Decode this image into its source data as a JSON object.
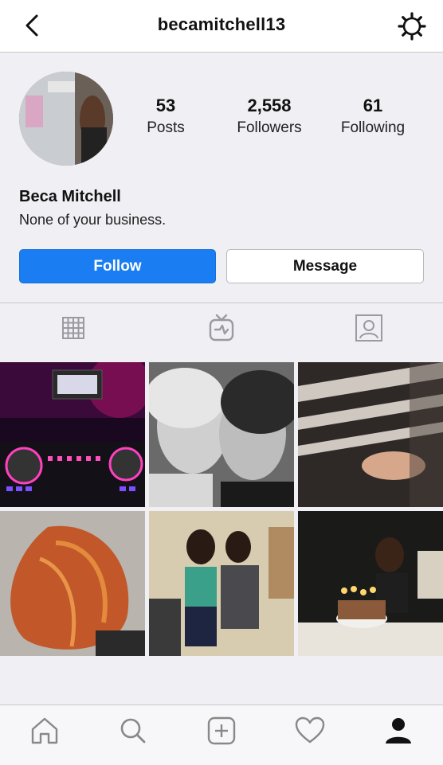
{
  "header": {
    "username": "becamitchell13",
    "back_icon": "chevron-left-icon",
    "settings_icon": "gear-icon"
  },
  "profile": {
    "stats": [
      {
        "value": "53",
        "label": "Posts"
      },
      {
        "value": "2,558",
        "label": "Followers"
      },
      {
        "value": "61",
        "label": "Following"
      }
    ],
    "display_name": "Beca Mitchell",
    "bio": "None of your business."
  },
  "actions": {
    "follow_label": "Follow",
    "message_label": "Message"
  },
  "tabs": [
    "grid-icon",
    "igtv-icon",
    "tagged-icon"
  ],
  "posts": [
    {
      "subject": "dj controller"
    },
    {
      "subject": "two friends selfie"
    },
    {
      "subject": "vinyl records"
    },
    {
      "subject": "red hair"
    },
    {
      "subject": "friends saluting"
    },
    {
      "subject": "birthday cake"
    }
  ],
  "bottom_nav": [
    "home-icon",
    "search-icon",
    "new-post-icon",
    "activity-heart-icon",
    "profile-icon"
  ],
  "colors": {
    "accent": "#1a7ef2",
    "background": "#efeff4"
  }
}
